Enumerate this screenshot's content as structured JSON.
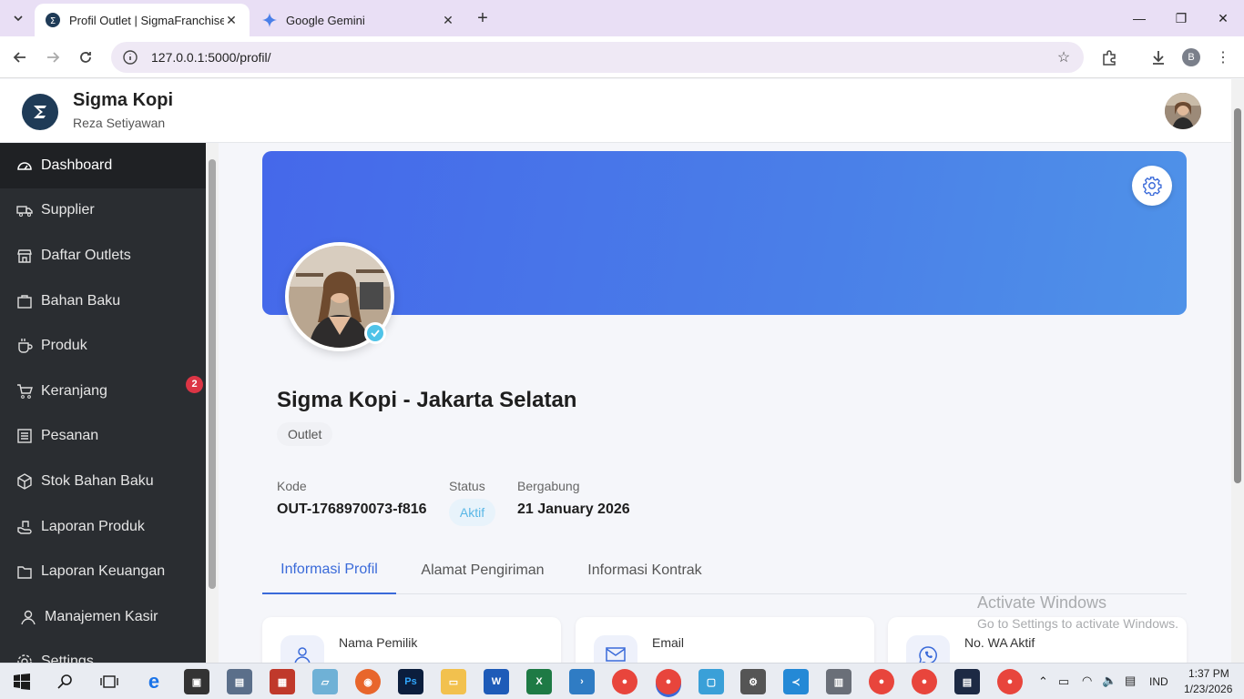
{
  "browser": {
    "tabs": [
      {
        "title": "Profil Outlet | SigmaFranchise",
        "active": true
      },
      {
        "title": "Google Gemini",
        "active": false
      }
    ],
    "url": "127.0.0.1:5000/profil/",
    "profile_initial": "B"
  },
  "header": {
    "brand": "Sigma Kopi",
    "user": "Reza Setiyawan"
  },
  "sidebar": {
    "items": [
      {
        "label": "Dashboard",
        "icon": "gauge-icon",
        "active": true
      },
      {
        "label": "Supplier",
        "icon": "truck-icon"
      },
      {
        "label": "Daftar Outlets",
        "icon": "store-icon"
      },
      {
        "label": "Bahan Baku",
        "icon": "box-icon"
      },
      {
        "label": "Produk",
        "icon": "cup-icon"
      },
      {
        "label": "Keranjang",
        "icon": "cart-icon",
        "badge": "2"
      },
      {
        "label": "Pesanan",
        "icon": "list-icon"
      },
      {
        "label": "Stok Bahan Baku",
        "icon": "cube-icon"
      },
      {
        "label": "Laporan Produk",
        "icon": "hand-icon"
      },
      {
        "label": "Laporan Keuangan",
        "icon": "folder-icon"
      },
      {
        "label": "Manajemen Kasir",
        "icon": "user-icon"
      },
      {
        "label": "Settings",
        "icon": "gear-icon"
      }
    ]
  },
  "profile": {
    "name": "Sigma Kopi - Jakarta Selatan",
    "type": "Outlet",
    "kode_label": "Kode",
    "kode": "OUT-1768970073-f816",
    "status_label": "Status",
    "status": "Aktif",
    "bergabung_label": "Bergabung",
    "bergabung": "21 January 2026"
  },
  "tabs": [
    {
      "label": "Informasi Profil",
      "active": true
    },
    {
      "label": "Alamat Pengiriman"
    },
    {
      "label": "Informasi Kontrak"
    }
  ],
  "cards": [
    {
      "label": "Nama Pemilik",
      "icon": "user-icon"
    },
    {
      "label": "Email",
      "icon": "envelope-icon"
    },
    {
      "label": "No. WA Aktif",
      "icon": "whatsapp-icon"
    }
  ],
  "watermark": {
    "line1": "Activate Windows",
    "line2": "Go to Settings to activate Windows."
  },
  "taskbar": {
    "lang": "IND",
    "time": "1:37 PM",
    "date": "1/23/2026"
  },
  "colors": {
    "accent": "#3a6ad9",
    "sidebar": "#2a2d31",
    "badge": "#dc3545",
    "status": "#59b7e6"
  }
}
